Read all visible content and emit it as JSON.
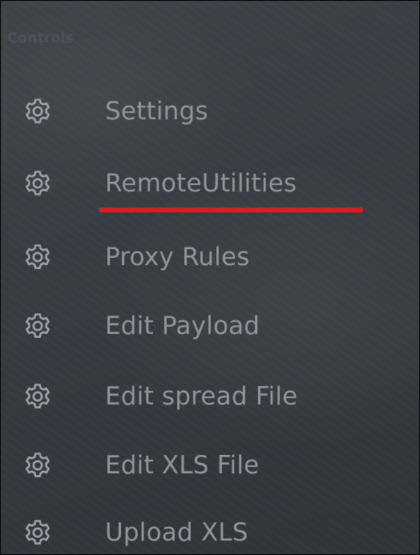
{
  "section": {
    "title": "Controls"
  },
  "menu": {
    "items": [
      {
        "label": "Settings",
        "icon": "gear-icon"
      },
      {
        "label": "RemoteUtilities",
        "icon": "gear-icon"
      },
      {
        "label": "Proxy Rules",
        "icon": "gear-icon"
      },
      {
        "label": "Edit Payload",
        "icon": "gear-icon"
      },
      {
        "label": "Edit spread File",
        "icon": "gear-icon"
      },
      {
        "label": "Edit XLS File",
        "icon": "gear-icon"
      },
      {
        "label": "Upload XLS",
        "icon": "gear-icon"
      }
    ]
  },
  "annotation": {
    "underline_color": "#e8191c",
    "underlined_item": "RemoteUtilities"
  },
  "colors": {
    "background": "#363c41",
    "label": "#8e959b",
    "section_title": "#4b5259",
    "icon": "#9ba2a8"
  }
}
